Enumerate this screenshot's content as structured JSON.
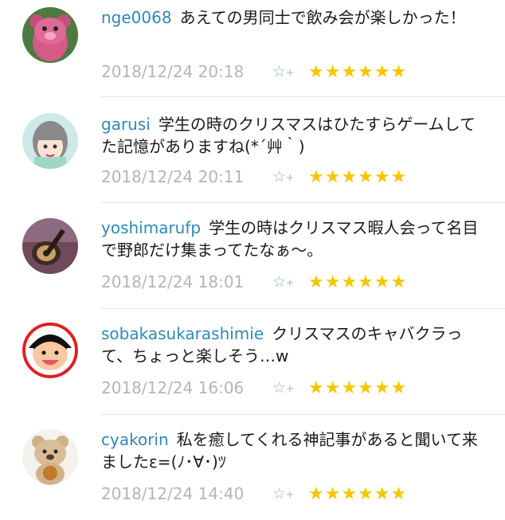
{
  "comments": [
    {
      "user": "nge0068",
      "text": "あえての男同士で飲み会が楽しかった！",
      "time": "2018/12/24 20:18",
      "stars": "★★★★★★",
      "avatar": "pink-bear-avatar"
    },
    {
      "user": "garusi",
      "text": "学生の時のクリスマスはひたすらゲームしてた記憶がありますね(*´艸｀)",
      "time": "2018/12/24 20:11",
      "stars": "★★★★★★",
      "avatar": "girl-illustration-avatar"
    },
    {
      "user": "yoshimarufp",
      "text": "学生の時はクリスマス暇人会って名目で野郎だけ集まってたなぁ～。",
      "time": "2018/12/24 18:01",
      "stars": "★★★★★★",
      "avatar": "guitar-avatar"
    },
    {
      "user": "sobakasukarashimie",
      "text": "クリスマスのキャバクラって、ちょっと楽しそう…w",
      "time": "2018/12/24 16:06",
      "stars": "★★★★★★",
      "avatar": "cartoon-girl-avatar"
    },
    {
      "user": "cyakorin",
      "text": "私を癒してくれる神記事があると聞いて来ましたε=(ﾉ･∀･)ﾂ",
      "time": "2018/12/24 14:40",
      "stars": "★★★★★★",
      "avatar": "teddy-bear-avatar"
    }
  ],
  "fav_icon": "☆",
  "fav_plus": "+",
  "colors": {
    "username": "#2d89b8",
    "star": "#f6c600",
    "timestamp": "#b5b5b5"
  }
}
